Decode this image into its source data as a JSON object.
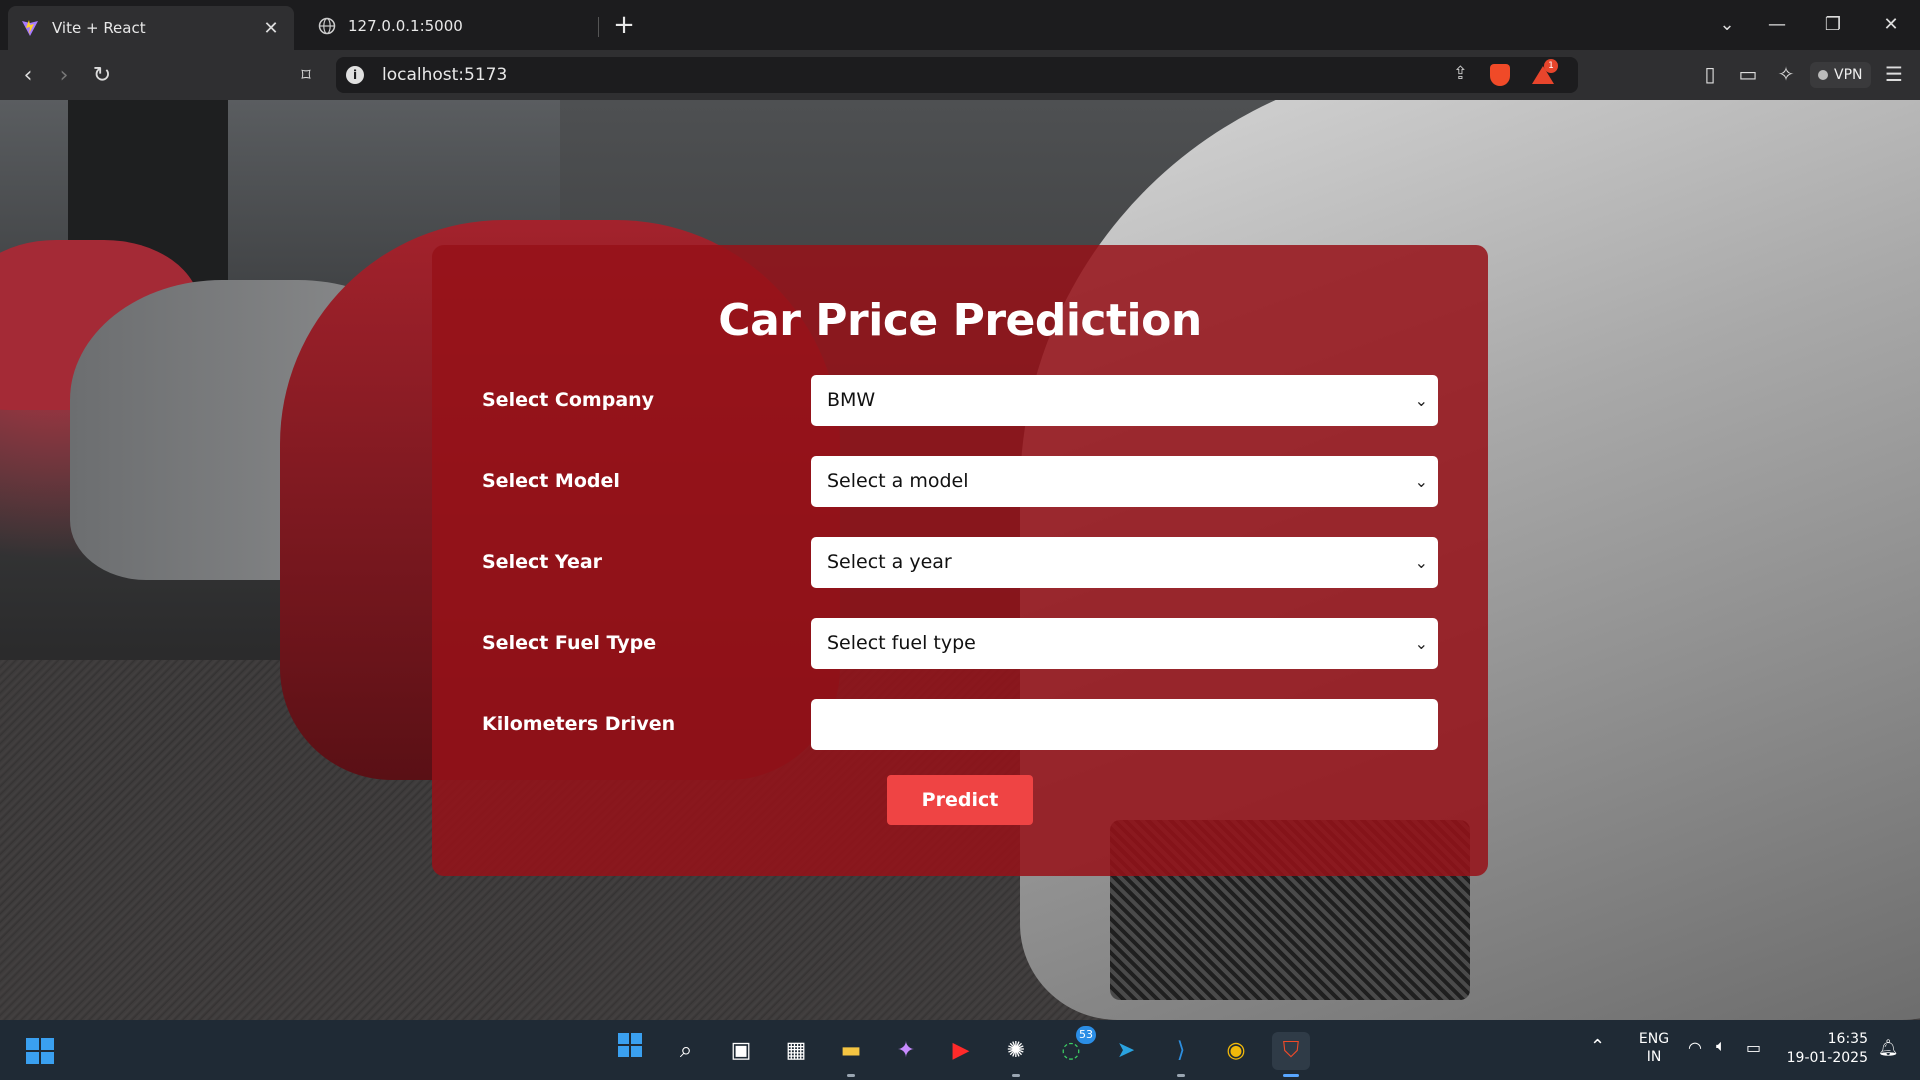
{
  "browser": {
    "tabs": [
      {
        "title": "Vite + React",
        "active": true,
        "icon": "vite-icon"
      },
      {
        "title": "127.0.0.1:5000",
        "active": false,
        "icon": "globe-icon"
      }
    ],
    "url": "localhost:5173",
    "vpn_label": "VPN",
    "notification_count": "1"
  },
  "form": {
    "title": "Car Price Prediction",
    "fields": [
      {
        "label": "Select Company",
        "value": "BMW",
        "type": "select"
      },
      {
        "label": "Select Model",
        "value": "Select a model",
        "type": "select"
      },
      {
        "label": "Select Year",
        "value": "Select a year",
        "type": "select"
      },
      {
        "label": "Select Fuel Type",
        "value": "Select fuel type",
        "type": "select"
      },
      {
        "label": "Kilometers Driven",
        "value": "",
        "type": "input"
      }
    ],
    "submit_label": "Predict"
  },
  "taskbar": {
    "whatsapp_badge": "53",
    "language": "ENG",
    "region": "IN",
    "time": "16:35",
    "date": "19-01-2025"
  },
  "colors": {
    "card": "#961219",
    "button": "#ef4444",
    "taskbar": "#1f2a35"
  }
}
